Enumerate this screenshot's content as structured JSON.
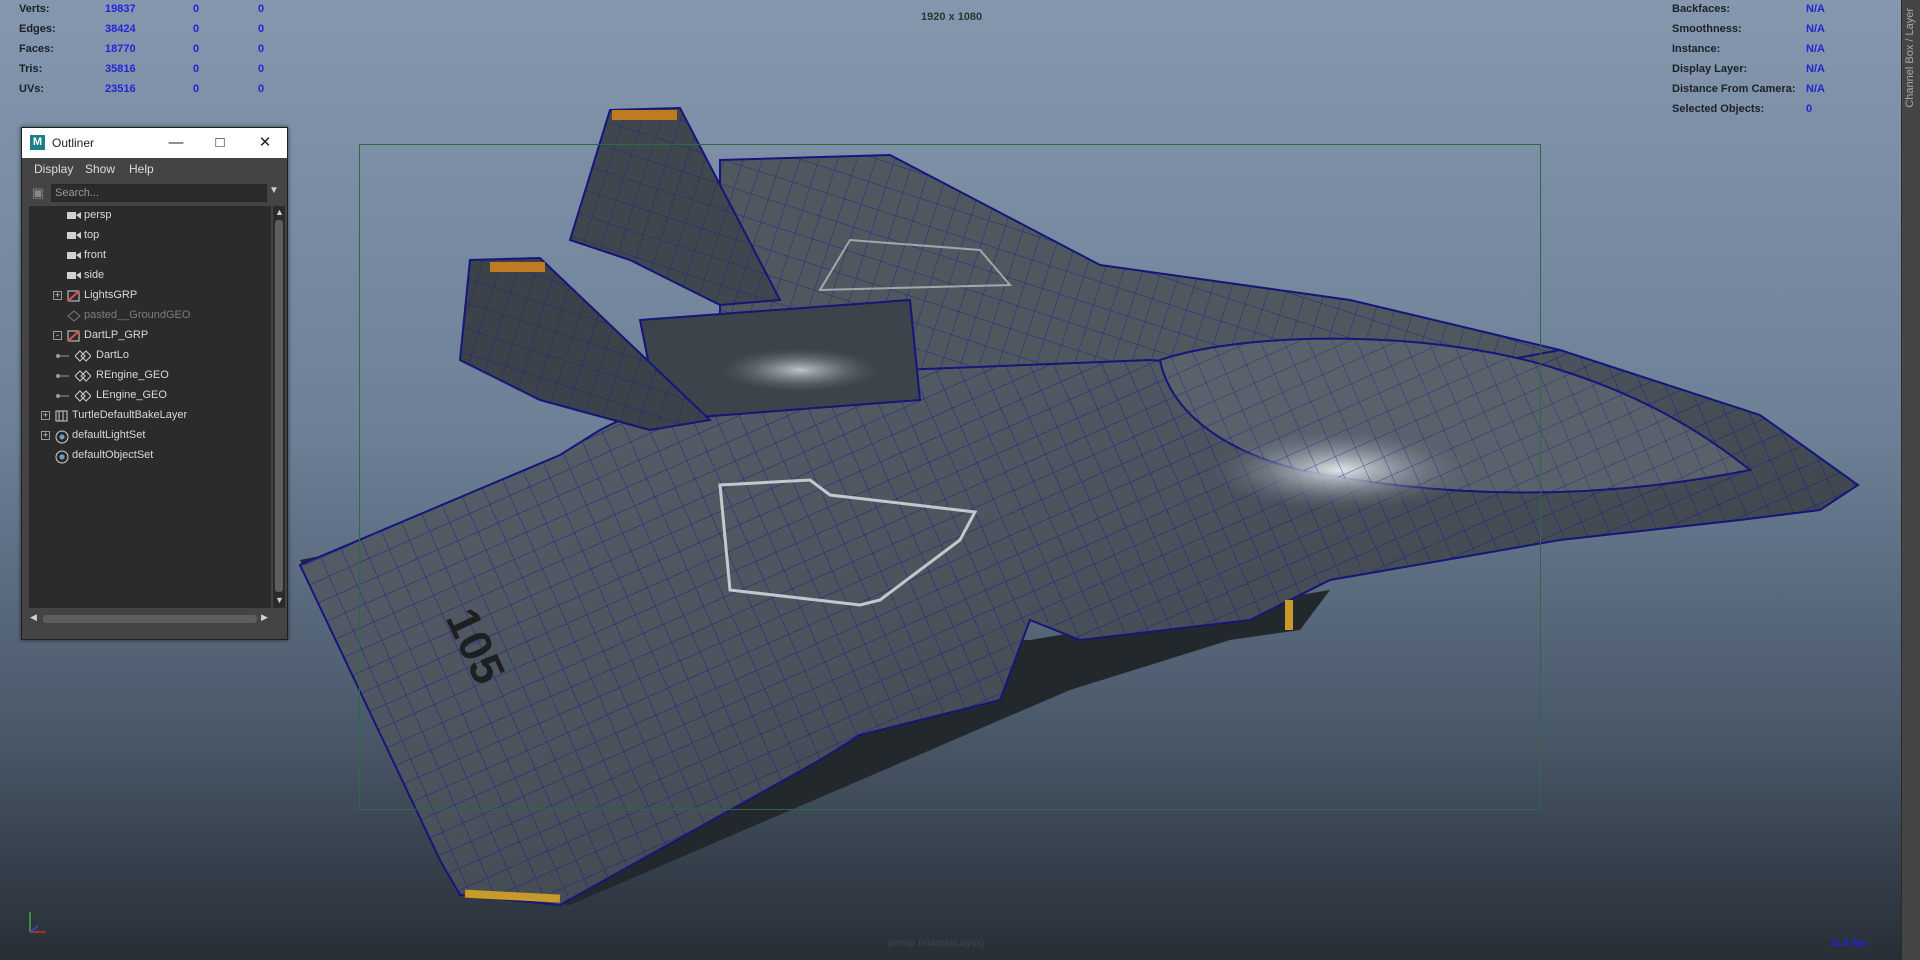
{
  "hud": {
    "resolution": "1920 x 1080",
    "camera_label": "persp (masterLayer)",
    "fps": "11.6 fps",
    "poly_stats": [
      {
        "label": "Verts:",
        "value": "19837",
        "sel": "0",
        "comp": "0"
      },
      {
        "label": "Edges:",
        "value": "38424",
        "sel": "0",
        "comp": "0"
      },
      {
        "label": "Faces:",
        "value": "18770",
        "sel": "0",
        "comp": "0"
      },
      {
        "label": "Tris:",
        "value": "35816",
        "sel": "0",
        "comp": "0"
      },
      {
        "label": "UVs:",
        "value": "23516",
        "sel": "0",
        "comp": "0"
      }
    ],
    "object_info": [
      {
        "label": "Backfaces:",
        "value": "N/A"
      },
      {
        "label": "Smoothness:",
        "value": "N/A"
      },
      {
        "label": "Instance:",
        "value": "N/A"
      },
      {
        "label": "Display Layer:",
        "value": "N/A"
      },
      {
        "label": "Distance From Camera:",
        "value": "N/A"
      },
      {
        "label": "Selected Objects:",
        "value": "0"
      }
    ]
  },
  "channel_box_tab": "Channel Box / Layer",
  "outliner": {
    "title": "Outliner",
    "menu": [
      "Display",
      "Show",
      "Help"
    ],
    "search_placeholder": "Search...",
    "items": [
      {
        "label": "persp",
        "icon": "camera-icon",
        "expand": "",
        "dim": false
      },
      {
        "label": "top",
        "icon": "camera-icon",
        "expand": "",
        "dim": false
      },
      {
        "label": "front",
        "icon": "camera-icon",
        "expand": "",
        "dim": false
      },
      {
        "label": "side",
        "icon": "camera-icon",
        "expand": "",
        "dim": false
      },
      {
        "label": "LightsGRP",
        "icon": "group-icon",
        "expand": "+",
        "dim": false
      },
      {
        "label": "pasted__GroundGEO",
        "icon": "mesh-icon",
        "expand": "",
        "dim": true
      },
      {
        "label": "DartLP_GRP",
        "icon": "group-icon",
        "expand": "-",
        "dim": false
      },
      {
        "label": "DartLo",
        "icon": "mesh-icon",
        "expand": "",
        "dim": false
      },
      {
        "label": "REngine_GEO",
        "icon": "mesh-icon",
        "expand": "",
        "dim": false
      },
      {
        "label": "LEngine_GEO",
        "icon": "mesh-icon",
        "expand": "",
        "dim": false
      },
      {
        "label": "TurtleDefaultBakeLayer",
        "icon": "bake-layer-icon",
        "expand": "+",
        "dim": false
      },
      {
        "label": "defaultLightSet",
        "icon": "set-icon",
        "expand": "+",
        "dim": false
      },
      {
        "label": "defaultObjectSet",
        "icon": "set-icon",
        "expand": "",
        "dim": false
      }
    ]
  },
  "ship": {
    "hull_number": "105"
  }
}
